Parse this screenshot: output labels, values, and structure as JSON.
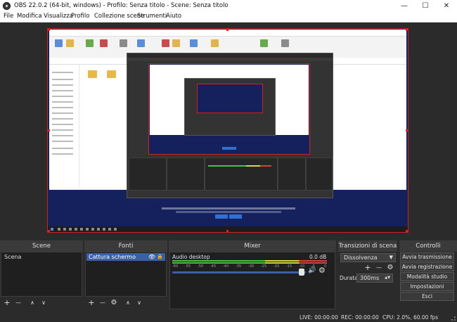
{
  "window": {
    "title": "OBS 22.0.2 (64-bit, windows) - Profilo: Senza titolo - Scene: Senza titolo",
    "minimize": "—",
    "maximize": "☐",
    "close": "✕"
  },
  "menu": [
    "File",
    "Modifica",
    "Visualizza",
    "Profilo",
    "Collezione scene",
    "Strumenti",
    "Aiuto"
  ],
  "docks": {
    "scenes": {
      "title": "Scene",
      "items": [
        "Scena"
      ]
    },
    "sources": {
      "title": "Fonti",
      "items": [
        "Cattura schermo"
      ]
    },
    "mixer": {
      "title": "Mixer",
      "track": {
        "name": "Audio desktop",
        "level": "0.0 dB"
      },
      "scale": [
        "-60",
        "-55",
        "-50",
        "-45",
        "-40",
        "-35",
        "-30",
        "-25",
        "-20",
        "-15",
        "-10",
        "-5",
        "0"
      ]
    },
    "transitions": {
      "title": "Transizioni di scena",
      "selected": "Dissolvenza",
      "duration_label": "Durata",
      "duration_value": "300ms"
    },
    "controls": {
      "title": "Controlli",
      "buttons": [
        "Avvia trasmissione",
        "Avvia registrazione",
        "Modalità studio",
        "Impostazioni",
        "Esci"
      ]
    }
  },
  "status": {
    "live": "LIVE: 00:00:00",
    "rec": "REC: 00:00:00",
    "cpu": "CPU: 2.0%, 60.00 fps"
  },
  "icons": {
    "add": "+",
    "remove": "—",
    "settings": "⚙",
    "up": "∧",
    "down": "∨",
    "eye": "👁",
    "lock": "🔒",
    "speaker": "🔊"
  },
  "colors": {
    "background": "#2b2b2b",
    "dock_body": "#1f1f1f",
    "selection": "#3b5fa8",
    "preview_border": "#c22222"
  }
}
